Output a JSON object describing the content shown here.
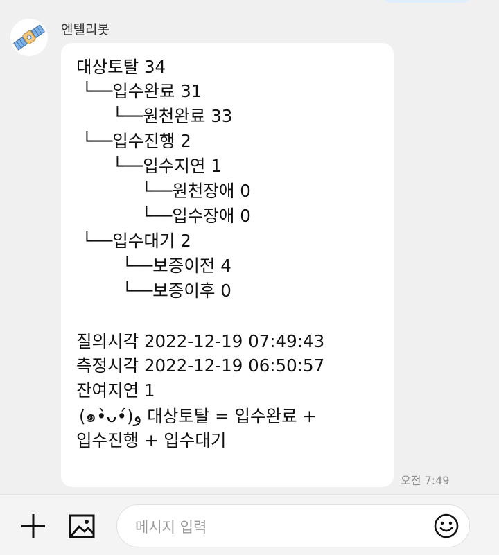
{
  "chat": {
    "sender_name": "엔텔리봇",
    "message_lines": [
      "대상토탈 34",
      "└──입수완료 31",
      "└──원천완료 33",
      "└──입수진행 2",
      "└──입수지연 1",
      "└──원천장애 0",
      "└──입수장애 0",
      "└──입수대기 2",
      "└──보증이전 4",
      "└──보증이후 0",
      "질의시각 2022-12-19 07:49:43",
      "측정시각 2022-12-19 06:50:57",
      "잔여지연 1",
      "(๑•̀ᴗ•́)و 대상토탈 = 입수완료 +",
      "입수진행 + 입수대기"
    ],
    "timestamp": "오전 7:49"
  },
  "composer": {
    "placeholder": "메시지 입력",
    "add_icon": "plus-icon",
    "image_icon": "image-icon",
    "emoji_icon": "smiley-icon"
  },
  "colors": {
    "background": "#f0f0f1",
    "bubble": "#ffffff",
    "timestamp": "#8d8d8d"
  }
}
